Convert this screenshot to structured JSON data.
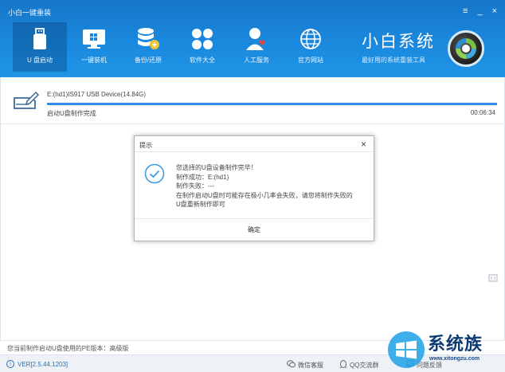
{
  "window": {
    "title": "小白一键重装",
    "controls": [
      "≡",
      "_",
      "×"
    ]
  },
  "nav": [
    {
      "label": "U 盘启动",
      "icon": "usb-icon",
      "active": true
    },
    {
      "label": "一键装机",
      "icon": "monitor-icon",
      "active": false
    },
    {
      "label": "备份/还原",
      "icon": "database-icon",
      "active": false
    },
    {
      "label": "软件大全",
      "icon": "apps-icon",
      "active": false
    },
    {
      "label": "人工服务",
      "icon": "support-person-icon",
      "active": false
    },
    {
      "label": "官方网站",
      "icon": "globe-icon",
      "active": false
    }
  ],
  "brand": {
    "name": "小白系统",
    "slogan": "最好用的系统重装工具"
  },
  "device": {
    "name": "E:(hd1)IS917 USB Device(14.84G)",
    "status": "启动U盘制作完成",
    "elapsed": "00:06:34",
    "progress": 1.0
  },
  "dialog": {
    "title": "提示",
    "close": "×",
    "lines": [
      "您选择的U盘设备制作完毕！",
      "制作成功：E:(hd1)",
      "制作失败：---",
      "在制作启动U盘时可能存在极小几率会失败，请您将制作失败的",
      "U盘重新制作即可"
    ],
    "ok_label": "确定"
  },
  "info_bar": {
    "text": "您当前制作启动U盘使用的PE版本：高级版"
  },
  "status_bar": {
    "version": "VER[2.5.44.1203]",
    "wechat": "微信客服",
    "qq": "QQ交流群",
    "feedback": "问题反馈"
  },
  "watermark": {
    "text": "系统族",
    "url": "www.xitongzu.com"
  },
  "colors": {
    "header": "#1a88dd",
    "accent": "#2e8fe0",
    "check": "#3d9be3"
  }
}
